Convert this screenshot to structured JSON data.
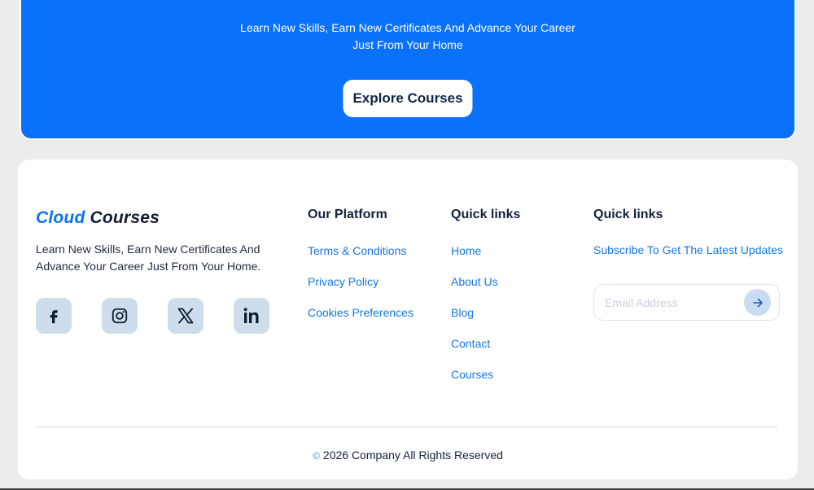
{
  "hero": {
    "subtitle": "Learn New Skills, Earn New Certificates And Advance Your Career Just From Your Home",
    "explore_button": "Explore Courses"
  },
  "brand": {
    "name_part1": "Cloud",
    "name_part2": "Courses",
    "description": "Learn New Skills, Earn New Certificates And Advance Your Career Just From Your Home."
  },
  "socials": [
    {
      "icon": "facebook-icon"
    },
    {
      "icon": "instagram-icon"
    },
    {
      "icon": "x-twitter-icon"
    },
    {
      "icon": "linkedin-icon"
    }
  ],
  "platform": {
    "title": "Our Platform",
    "links": [
      "Terms & Conditions",
      "Privacy Policy",
      "Cookies Preferences"
    ]
  },
  "quick_links": {
    "title": "Quick links",
    "links": [
      "Home",
      "About Us",
      "Blog",
      "Contact",
      "Courses"
    ]
  },
  "subscribe": {
    "title": "Quick links",
    "text": "Subscribe To Get The Latest Updates",
    "placeholder": "Email Address"
  },
  "copyright": {
    "symbol": "©",
    "text": "2026 Company All Rights Reserved"
  },
  "colors": {
    "accent": "#0a71fa",
    "link": "#1577e6",
    "social_bg": "#cdddec",
    "text_dark": "#13223f"
  }
}
